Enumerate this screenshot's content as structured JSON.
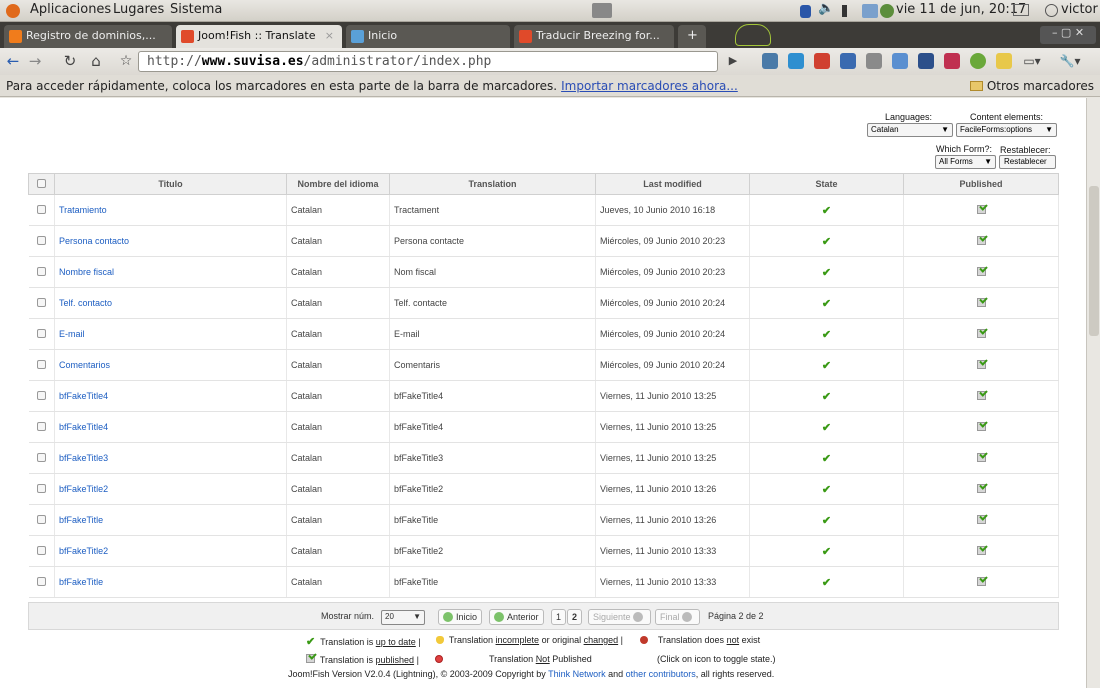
{
  "panel": {
    "apps": "Aplicaciones",
    "places": "Lugares",
    "system": "Sistema",
    "datetime": "vie 11 de jun, 20:17",
    "user": "victor"
  },
  "tabs": [
    {
      "label": "Registro de dominios,...",
      "color": "#f07c1c"
    },
    {
      "label": "Joom!Fish :: Translate",
      "color": "#e04a2a"
    },
    {
      "label": "Inicio",
      "color": "#5aa0d8"
    },
    {
      "label": "Traducir Breezing for...",
      "color": "#e04a2a"
    }
  ],
  "toolbar": {
    "url_prefix": "http://",
    "url_host": "www.suvisa.es",
    "url_path": "/administrator/index.php"
  },
  "bookmarks": {
    "hint": "Para acceder rápidamente, coloca los marcadores en esta parte de la barra de marcadores.",
    "import_link": "Importar marcadores ahora...",
    "other": "Otros marcadores"
  },
  "filters": {
    "languages_label": "Languages:",
    "languages_value": "Catalan",
    "content_label": "Content elements:",
    "content_value": "FacileForms:options",
    "form_label": "Which Form?:",
    "form_value": "All Forms",
    "reset_label": "Restablecer:",
    "reset_button": "Restablecer"
  },
  "table": {
    "headers": [
      "Titulo",
      "Nombre del idioma",
      "Translation",
      "Last modified",
      "State",
      "Published"
    ],
    "rows": [
      {
        "title": "Tratamiento",
        "lang": "Catalan",
        "translation": "Tractament",
        "modified": "Jueves, 10 Junio 2010 16:18"
      },
      {
        "title": "Persona contacto",
        "lang": "Catalan",
        "translation": "Persona contacte",
        "modified": "Miércoles, 09 Junio 2010 20:23"
      },
      {
        "title": "Nombre fiscal",
        "lang": "Catalan",
        "translation": "Nom fiscal",
        "modified": "Miércoles, 09 Junio 2010 20:23"
      },
      {
        "title": "Telf. contacto",
        "lang": "Catalan",
        "translation": "Telf. contacte",
        "modified": "Miércoles, 09 Junio 2010 20:24"
      },
      {
        "title": "E-mail",
        "lang": "Catalan",
        "translation": "E-mail",
        "modified": "Miércoles, 09 Junio 2010 20:24"
      },
      {
        "title": "Comentarios",
        "lang": "Catalan",
        "translation": "Comentaris",
        "modified": "Miércoles, 09 Junio 2010 20:24"
      },
      {
        "title": "bfFakeTitle4",
        "lang": "Catalan",
        "translation": "bfFakeTitle4",
        "modified": "Viernes, 11 Junio 2010 13:25"
      },
      {
        "title": "bfFakeTitle4",
        "lang": "Catalan",
        "translation": "bfFakeTitle4",
        "modified": "Viernes, 11 Junio 2010 13:25"
      },
      {
        "title": "bfFakeTitle3",
        "lang": "Catalan",
        "translation": "bfFakeTitle3",
        "modified": "Viernes, 11 Junio 2010 13:25"
      },
      {
        "title": "bfFakeTitle2",
        "lang": "Catalan",
        "translation": "bfFakeTitle2",
        "modified": "Viernes, 11 Junio 2010 13:26"
      },
      {
        "title": "bfFakeTitle",
        "lang": "Catalan",
        "translation": "bfFakeTitle",
        "modified": "Viernes, 11 Junio 2010 13:26"
      },
      {
        "title": "bfFakeTitle2",
        "lang": "Catalan",
        "translation": "bfFakeTitle2",
        "modified": "Viernes, 11 Junio 2010 13:33"
      },
      {
        "title": "bfFakeTitle",
        "lang": "Catalan",
        "translation": "bfFakeTitle",
        "modified": "Viernes, 11 Junio 2010 13:33"
      }
    ]
  },
  "pager": {
    "show_label": "Mostrar núm.",
    "show_value": "20",
    "first": "Inicio",
    "prev": "Anterior",
    "page1": "1",
    "page2": "2",
    "next": "Siguiente",
    "last": "Final",
    "page_info": "Página 2 de 2"
  },
  "legend": {
    "a": "Translation is ",
    "a_u": "up to date",
    "a_end": " |",
    "b": "Translation ",
    "b_u1": "incomplete",
    "b_mid": " or original ",
    "b_u2": "changed",
    "b_end": " |",
    "c": "Translation does ",
    "c_u": "not",
    "c_end": " exist",
    "d": "Translation is ",
    "d_u": "published",
    "d_end": " |",
    "e": "Translation ",
    "e_u": "Not",
    "e_end": " Published",
    "f": "(Click on icon to toggle state.)",
    "footer_a": "Joom!Fish Version V2.0.4 (Lightning), © 2003-2009 Copyright by ",
    "footer_link1": "Think Network",
    "footer_b": " and ",
    "footer_link2": "other contributors",
    "footer_c": ", all rights reserved."
  }
}
